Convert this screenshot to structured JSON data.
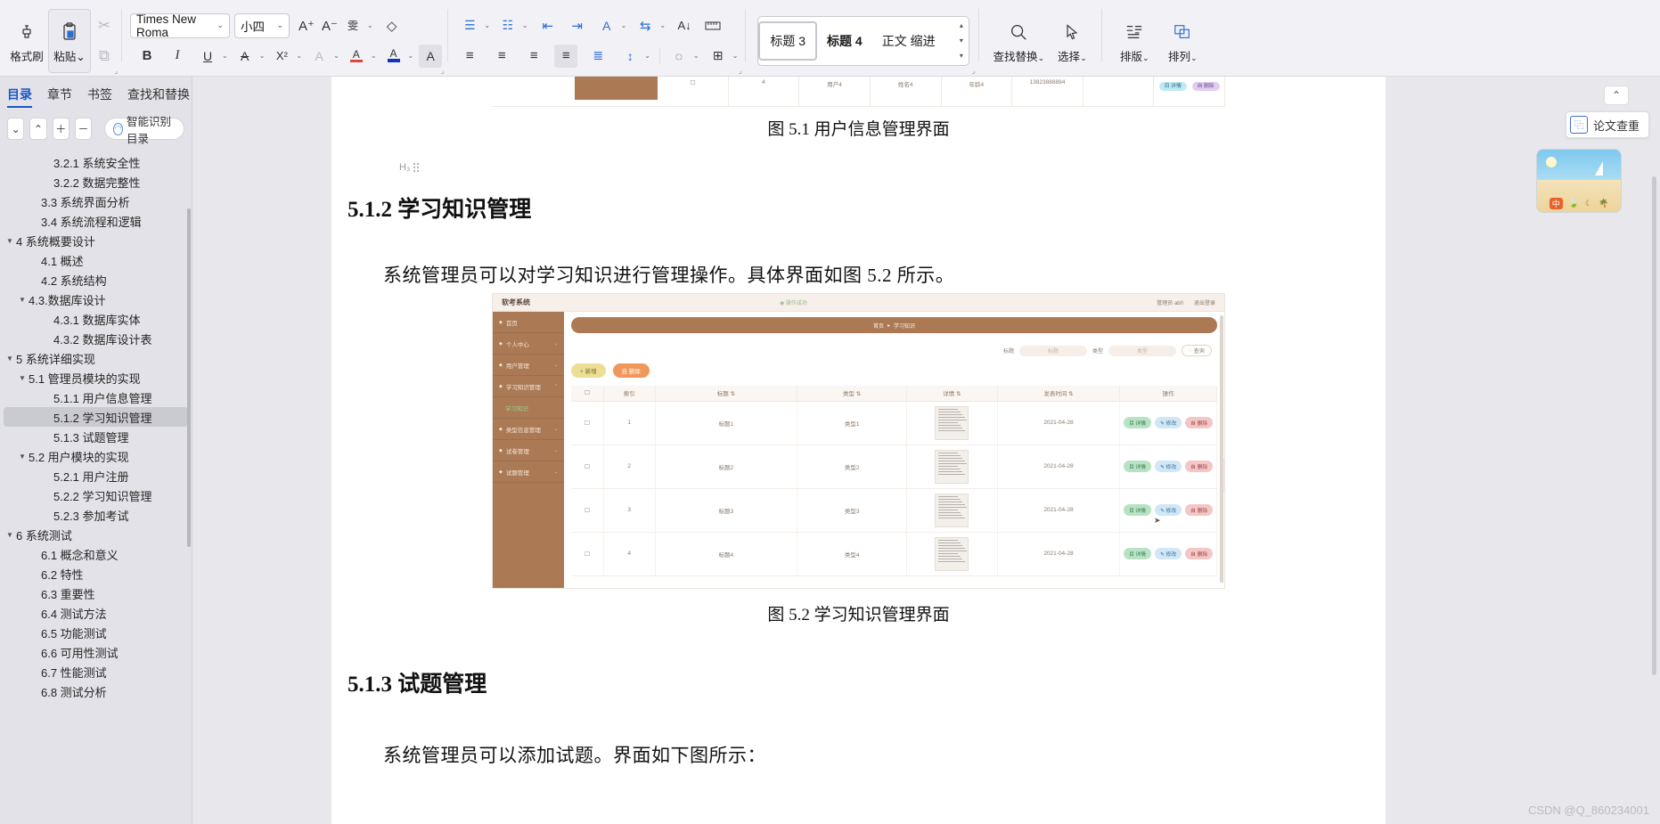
{
  "ribbon": {
    "clipboard": [
      {
        "name": "format-painter",
        "label": "格式刷",
        "icon": "brush"
      },
      {
        "name": "paste",
        "label": "粘贴",
        "icon": "clipboard",
        "caret": "⌄"
      }
    ],
    "cut_label": "✂",
    "copy_label": "⧉",
    "font": {
      "family_value": "Times New Roma",
      "size_value": "小四",
      "grow_label": "A⁺",
      "shrink_label": "A⁻",
      "pinyin_label": "雯",
      "clear_format_label": "◇",
      "bold_label": "B",
      "italic_label": "I",
      "underline_label": "U",
      "strike_label": "A",
      "superscript_label": "X²",
      "char_border_label": "A",
      "highlight_label": "A",
      "font_color_label": "A",
      "text_effect_label": "A"
    },
    "paragraph": {
      "bullets_label": "☰",
      "numbering_label": "☷",
      "decrease_indent_label": "⇤",
      "increase_indent_label": "⇥",
      "pinyin_guide_label": "A",
      "sort_label": "⇆",
      "sort_az_label": "A↓",
      "show_marks_label": "¶",
      "align_left_label": "≡",
      "align_center_label": "≡",
      "align_right_label": "≡",
      "align_justify_label": "≡",
      "distribute_label": "≣",
      "line_spacing_label": "↕",
      "shading_label": "◌",
      "borders_label": "⊞"
    },
    "styles": {
      "items": [
        {
          "label": "标题 3",
          "active": true
        },
        {
          "label": "标题 4",
          "active": false
        },
        {
          "label": "正文 缩进",
          "active": false
        }
      ],
      "scroll_up": "▴",
      "scroll_down": "▾",
      "more": "▾"
    },
    "editing": [
      {
        "name": "find-replace",
        "label": "查找替换",
        "icon": "search",
        "caret": "⌄"
      },
      {
        "name": "select",
        "label": "选择",
        "icon": "cursor",
        "caret": "⌄"
      }
    ],
    "layout": [
      {
        "name": "typeset",
        "label": "排版",
        "icon": "typeset",
        "caret": "⌄"
      },
      {
        "name": "arrange",
        "label": "排列",
        "icon": "arrange",
        "caret": "⌄"
      }
    ]
  },
  "nav": {
    "tabs": [
      {
        "label": "目录",
        "active": true
      },
      {
        "label": "章节",
        "active": false
      },
      {
        "label": "书签",
        "active": false
      },
      {
        "label": "查找和替换",
        "active": false
      }
    ],
    "close_label": "✕",
    "tools": [
      {
        "name": "collapse-down",
        "label": "⌄"
      },
      {
        "name": "collapse-up",
        "label": "⌃"
      },
      {
        "name": "expand-level",
        "label": "＋"
      },
      {
        "name": "collapse-level",
        "label": "－"
      }
    ],
    "smart_toc_label": "智能识别目录",
    "smart_toc_icon": "◠",
    "toc": [
      {
        "label": "3.2.1 系统安全性",
        "indent": 3,
        "arrow": "",
        "selected": false
      },
      {
        "label": "3.2.2 数据完整性",
        "indent": 3,
        "arrow": "",
        "selected": false
      },
      {
        "label": "3.3 系统界面分析",
        "indent": 2,
        "arrow": "",
        "selected": false
      },
      {
        "label": "3.4 系统流程和逻辑",
        "indent": 2,
        "arrow": "",
        "selected": false
      },
      {
        "label": "4 系统概要设计",
        "indent": 0,
        "arrow": "▼",
        "selected": false
      },
      {
        "label": "4.1 概述",
        "indent": 2,
        "arrow": "",
        "selected": false
      },
      {
        "label": "4.2 系统结构",
        "indent": 2,
        "arrow": "",
        "selected": false
      },
      {
        "label": "4.3.数据库设计",
        "indent": 1,
        "arrow": "▼",
        "selected": false
      },
      {
        "label": "4.3.1 数据库实体",
        "indent": 3,
        "arrow": "",
        "selected": false
      },
      {
        "label": "4.3.2 数据库设计表",
        "indent": 3,
        "arrow": "",
        "selected": false
      },
      {
        "label": "5 系统详细实现",
        "indent": 0,
        "arrow": "▼",
        "selected": false
      },
      {
        "label": "5.1 管理员模块的实现",
        "indent": 1,
        "arrow": "▼",
        "selected": false
      },
      {
        "label": "5.1.1 用户信息管理",
        "indent": 3,
        "arrow": "",
        "selected": false
      },
      {
        "label": "5.1.2 学习知识管理",
        "indent": 3,
        "arrow": "",
        "selected": true
      },
      {
        "label": "5.1.3 试题管理",
        "indent": 3,
        "arrow": "",
        "selected": false
      },
      {
        "label": "5.2 用户模块的实现",
        "indent": 1,
        "arrow": "▼",
        "selected": false
      },
      {
        "label": "5.2.1 用户注册",
        "indent": 3,
        "arrow": "",
        "selected": false
      },
      {
        "label": "5.2.2 学习知识管理",
        "indent": 3,
        "arrow": "",
        "selected": false
      },
      {
        "label": "5.2.3 参加考试",
        "indent": 3,
        "arrow": "",
        "selected": false
      },
      {
        "label": "6 系统测试",
        "indent": 0,
        "arrow": "▼",
        "selected": false
      },
      {
        "label": "6.1 概念和意义",
        "indent": 2,
        "arrow": "",
        "selected": false
      },
      {
        "label": "6.2 特性",
        "indent": 2,
        "arrow": "",
        "selected": false
      },
      {
        "label": "6.3 重要性",
        "indent": 2,
        "arrow": "",
        "selected": false
      },
      {
        "label": "6.4 测试方法",
        "indent": 2,
        "arrow": "",
        "selected": false
      },
      {
        "label": "6.5 功能测试",
        "indent": 2,
        "arrow": "",
        "selected": false
      },
      {
        "label": "6.6 可用性测试",
        "indent": 2,
        "arrow": "",
        "selected": false
      },
      {
        "label": "6.7 性能测试",
        "indent": 2,
        "arrow": "",
        "selected": false
      },
      {
        "label": "6.8 测试分析",
        "indent": 2,
        "arrow": "",
        "selected": false
      }
    ]
  },
  "document": {
    "paragraph_mark_label": "H₃",
    "figure51_caption": "图 5.1 用户信息管理界面",
    "figure51_strip": {
      "columns": [
        "",
        "4",
        "用户4",
        "姓名4",
        "年龄4",
        "13823888884",
        "",
        ""
      ],
      "detail_label": "目 详情",
      "delete_label": "自 删除"
    },
    "heading_512": "5.1.2  学习知识管理",
    "body_512": "系统管理员可以对学习知识进行管理操作。具体界面如图 5.2 所示。",
    "figure52_caption": "图 5.2  学习知识管理界面",
    "heading_513": "5.1.3  试题管理",
    "body_513": "系统管理员可以添加试题。界面如下图所示："
  },
  "embedded_app": {
    "brand": "软考系统",
    "toast": "操作成功",
    "user_label": "管理员 ab0",
    "logout_label": "退出登录",
    "sidebar": [
      {
        "label": "首页",
        "icon": "home",
        "chev": "",
        "active": false
      },
      {
        "label": "个人中心",
        "icon": "user",
        "chev": "⌄",
        "active": false
      },
      {
        "label": "用户管理",
        "icon": "bell",
        "chev": "⌄",
        "active": false
      },
      {
        "label": "学习知识管理",
        "icon": "flag",
        "chev": "⌃",
        "active": false
      },
      {
        "label": "学习知识",
        "icon": "",
        "chev": "",
        "active": true
      },
      {
        "label": "类型信息管理",
        "icon": "square",
        "chev": "⌄",
        "active": false
      },
      {
        "label": "试卷管理",
        "icon": "circle",
        "chev": "⌄",
        "active": false
      },
      {
        "label": "试题管理",
        "icon": "menu",
        "chev": "⌄",
        "active": false
      }
    ],
    "breadcrumb": [
      "首页",
      "学习知识"
    ],
    "breadcrumb_sep": "▸",
    "filters": [
      {
        "label": "标题",
        "placeholder": "标题"
      },
      {
        "label": "类型",
        "placeholder": "类型"
      }
    ],
    "search_button": "查询",
    "search_icon": "🔍",
    "add_button": "+ 新增",
    "delete_button": "自 删除",
    "table": {
      "headers": [
        "",
        "索引",
        "标题 ⇅",
        "类型 ⇅",
        "详情 ⇅",
        "发表时间 ⇅",
        "操作"
      ],
      "rows": [
        {
          "index": "1",
          "title": "标题1",
          "type": "类型1",
          "date": "2021-04-28"
        },
        {
          "index": "2",
          "title": "标题2",
          "type": "类型2",
          "date": "2021-04-28"
        },
        {
          "index": "3",
          "title": "标题3",
          "type": "类型3",
          "date": "2021-04-28"
        },
        {
          "index": "4",
          "title": "标题4",
          "type": "类型4",
          "date": "2021-04-28"
        }
      ],
      "op_detail": "目 详情",
      "op_edit": "✎ 修改",
      "op_delete": "自 删除"
    },
    "handle_label": "‹"
  },
  "right_widgets": {
    "collapse_label": "⌃",
    "paper_check_label": "论文查重",
    "paper_check_icon": "⿻",
    "promo_card_label": "中"
  },
  "watermark": "CSDN @Q_860234001",
  "colors": {
    "accent_blue": "#1a56c4",
    "ribbon_bg": "#f2f2f6",
    "nav_bg": "#e2e2e8",
    "app_brown": "#ab7a55",
    "selected_toc": "#cacad1"
  }
}
